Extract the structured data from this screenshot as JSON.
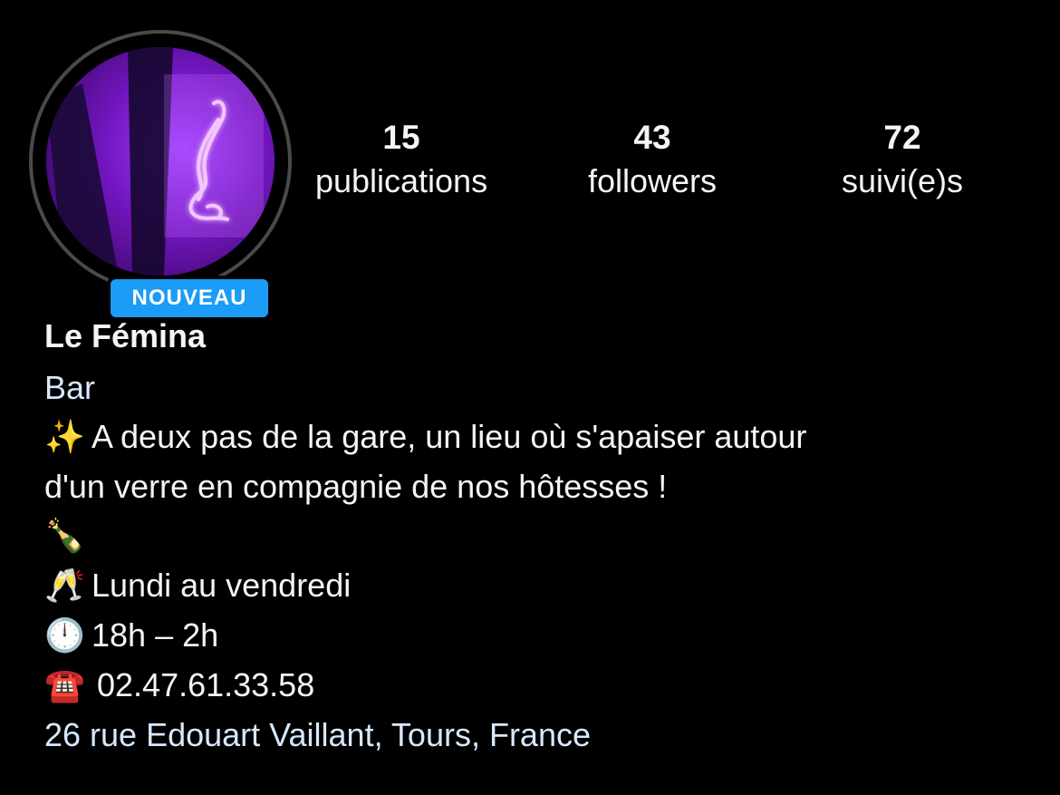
{
  "profile": {
    "badge": "NOUVEAU",
    "name": "Le Fémina",
    "category": "Bar"
  },
  "stats": [
    {
      "count": "15",
      "label": "publications"
    },
    {
      "count": "43",
      "label": "followers"
    },
    {
      "count": "72",
      "label": "suivi(e)s"
    }
  ],
  "bio": {
    "line1_emoji": "✨",
    "line1_text": "A deux pas de la gare, un lieu où s'apaiser autour",
    "line2_text": "d'un verre en compagnie de nos hôtesses !",
    "line3_emoji": "🍾",
    "line4_emoji": "🥂",
    "line4_text": "Lundi au vendredi",
    "line5_emoji": "🕛",
    "line5_text": "18h – 2h",
    "line6_emoji": "☎️",
    "line6_text": "02.47.61.33.58",
    "address": "26 rue Edouart Vaillant, Tours, France"
  },
  "colors": {
    "background": "#000000",
    "badge": "#1a9cf7",
    "link": "#d6e9ff",
    "ring": "#4a4a4a"
  }
}
